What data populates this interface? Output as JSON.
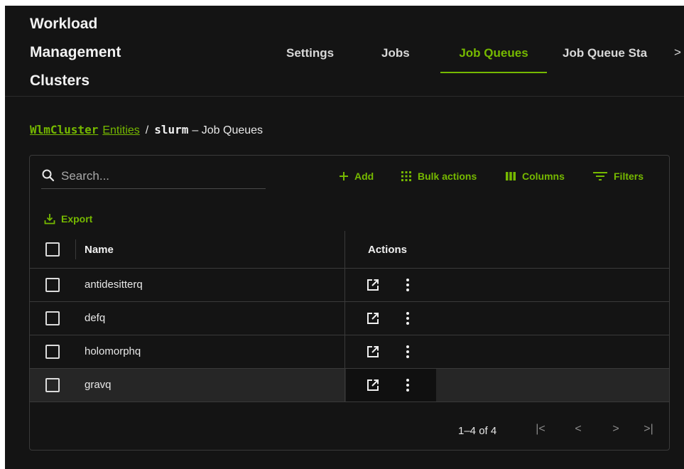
{
  "header": {
    "app_title_lines": [
      "Workload",
      "Management",
      "Clusters"
    ],
    "tabs": [
      {
        "label": "Settings"
      },
      {
        "label": "Jobs"
      },
      {
        "label": "Job Queues"
      },
      {
        "label": "Job Queue Sta"
      }
    ],
    "active_tab": "Job Queues",
    "more_tabs_glyph": ">"
  },
  "breadcrumb": {
    "entity": "WlmCluster",
    "entities_link": "Entities",
    "separator": "/",
    "name": "slurm",
    "suffix": "– Job Queues"
  },
  "toolbar": {
    "search_placeholder": "Search...",
    "add_label": "Add",
    "bulk_actions_label": "Bulk actions",
    "columns_label": "Columns",
    "filters_label": "Filters",
    "export_label": "Export"
  },
  "table": {
    "columns": [
      "Name",
      "Actions"
    ],
    "rows": [
      {
        "name": "antidesitterq"
      },
      {
        "name": "defq"
      },
      {
        "name": "holomorphq"
      },
      {
        "name": "gravq"
      }
    ]
  },
  "pagination": {
    "range_text": "1–4 of 4",
    "first": "|<",
    "prev": "<",
    "next": ">",
    "last": ">|"
  },
  "colors": {
    "accent": "#76b900",
    "background": "#141414",
    "border": "#3a3a3a"
  },
  "icons": [
    "search-icon",
    "plus-icon",
    "grid-dots-icon",
    "columns-icon",
    "filter-icon",
    "export-icon",
    "open-external-icon",
    "more-vertical-icon"
  ]
}
